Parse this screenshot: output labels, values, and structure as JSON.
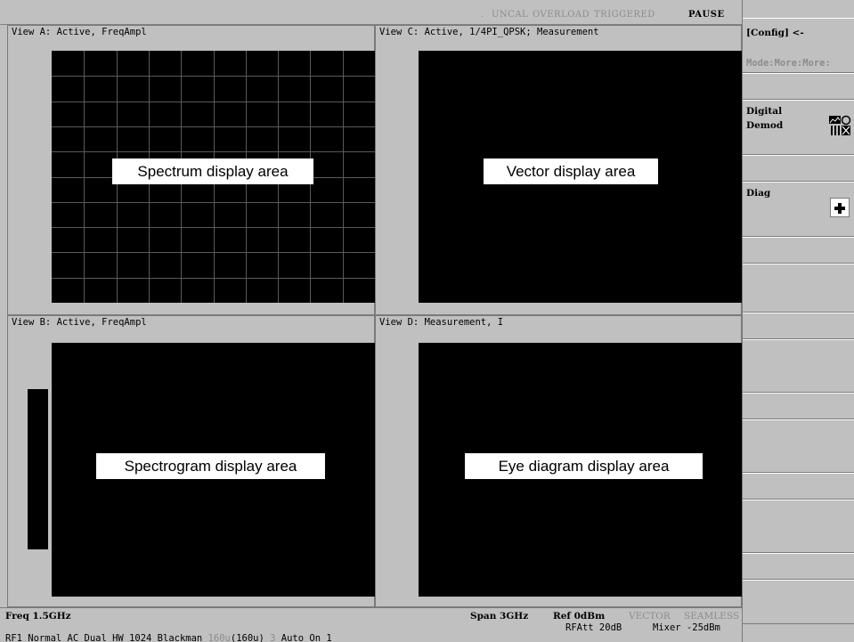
{
  "status": {
    "marker": ".",
    "uncal": "UNCAL",
    "overload": "OVERLOAD",
    "triggered": "TRIGGERED",
    "pause": "PAUSE"
  },
  "views": {
    "a": {
      "title": "View A: Active, FreqAmpl",
      "overlay": "Spectrum display area"
    },
    "c": {
      "title": "View C: Active, 1/4PI_QPSK; Measurement",
      "overlay": "Vector display area"
    },
    "b": {
      "title": "View B: Active, FreqAmpl",
      "overlay": "Spectrogram display area"
    },
    "d": {
      "title": "View D: Measurement, I",
      "overlay": "Eye diagram display area"
    }
  },
  "bottom": {
    "freq": "Freq 1.5GHz",
    "span": "Span 3GHz",
    "ref": "Ref 0dBm",
    "vector": "VECTOR",
    "seamless": "SEAMLESS",
    "rfatt": "RFAtt 20dB",
    "mixer": "Mixer -25dBm",
    "line2_a": "RF1 Normal AC Dual HW 1024 Blackman ",
    "line2_dim1": "160u",
    "line2_b": "(160u) ",
    "line2_dim2": "3",
    "line2_c": " Auto On 1"
  },
  "side_menu": {
    "config": "[Config] <-",
    "mode": "Mode:More:More:",
    "digital_demod": "Digital\nDemod",
    "diag": "Diag"
  },
  "icons": {
    "digital_demod": "digital-demod-icon",
    "diag": "plus-icon"
  },
  "colors": {
    "background": "#c0c0c0",
    "display": "#000000",
    "dim_text": "#8c8c8c",
    "grid": "#5a5a5a"
  }
}
